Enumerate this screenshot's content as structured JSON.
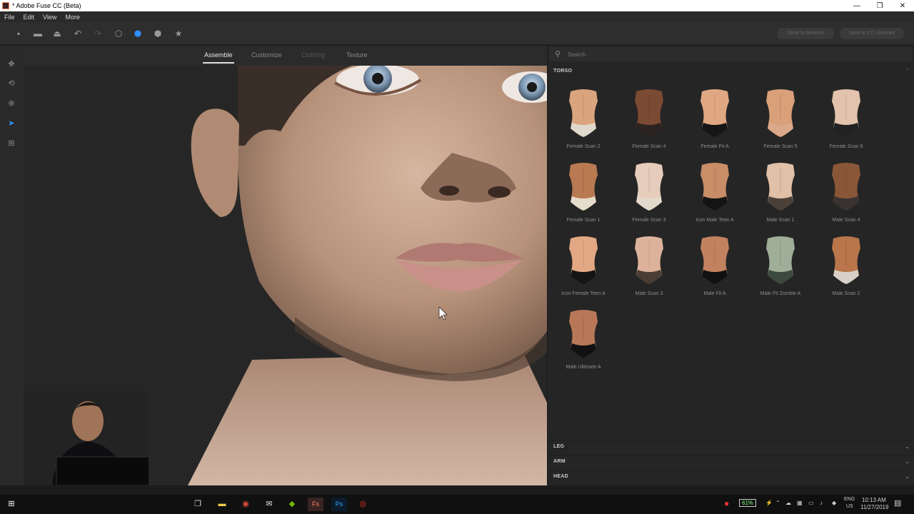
{
  "window": {
    "title": "* Adobe Fuse CC (Beta)",
    "controls": [
      "—",
      "❐",
      "✕"
    ]
  },
  "menu": [
    "File",
    "Edit",
    "View",
    "More"
  ],
  "toolbar": {
    "send_mixamo": "Send to Mixamo",
    "save_cc": "Save to CC Libraries"
  },
  "tabs": {
    "assemble": "Assemble",
    "customize": "Customize",
    "clothing": "Clothing",
    "texture": "Texture"
  },
  "search": {
    "placeholder": "Search"
  },
  "sections": {
    "torso": "TORSO",
    "leg": "LEG",
    "arm": "ARM",
    "head": "HEAD"
  },
  "torso_items": [
    {
      "label": "Female Scan 2",
      "skin": "#d9a47e",
      "garment": "#e0d8cc"
    },
    {
      "label": "Female Scan 4",
      "skin": "#7a4a32",
      "garment": "#2a2320"
    },
    {
      "label": "Female Fit A",
      "skin": "#e0a882",
      "garment": "#151515"
    },
    {
      "label": "Female Scan 5",
      "skin": "#d9a07a",
      "garment": "#dca88a"
    },
    {
      "label": "Female Scan 6",
      "skin": "#e3c3ad",
      "garment": "#222222"
    },
    {
      "label": "Female Scan 1",
      "skin": "#b97a52",
      "garment": "#e6dccb"
    },
    {
      "label": "Female Scan 3",
      "skin": "#e6cdbb",
      "garment": "#e2d9cc"
    },
    {
      "label": "Icon Male Teen A",
      "skin": "#c98d68",
      "garment": "#141414"
    },
    {
      "label": "Male Scan 1",
      "skin": "#e0c0a6",
      "garment": "#4a4038"
    },
    {
      "label": "Male Scan 4",
      "skin": "#8a5638",
      "garment": "#3a3230"
    },
    {
      "label": "Icon Female Teen A",
      "skin": "#e2a884",
      "garment": "#141414"
    },
    {
      "label": "Male Scan 3",
      "skin": "#dcb39a",
      "garment": "#4a3e34"
    },
    {
      "label": "Male Fit A",
      "skin": "#c2825f",
      "garment": "#111111"
    },
    {
      "label": "Male Fit Zombie A",
      "skin": "#9fae98",
      "garment": "#3c4a3e"
    },
    {
      "label": "Male Scan 2",
      "skin": "#b8764a",
      "garment": "#d8d0c6"
    },
    {
      "label": "Male Ultimate A",
      "skin": "#b87858",
      "garment": "#111111"
    }
  ],
  "taskbar": {
    "battery": "61%",
    "lang": "ENG",
    "region": "US",
    "time": "10:13 AM",
    "date": "11/27/2019"
  }
}
